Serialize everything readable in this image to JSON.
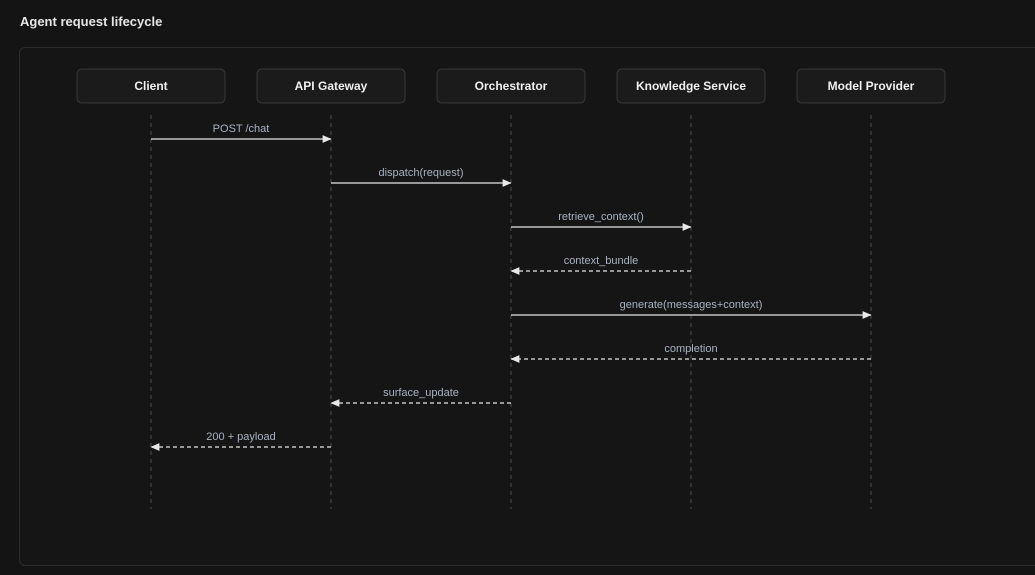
{
  "title": "Agent request lifecycle",
  "actors": [
    {
      "id": "client",
      "label": "Client"
    },
    {
      "id": "gateway",
      "label": "API Gateway"
    },
    {
      "id": "orchestrator",
      "label": "Orchestrator"
    },
    {
      "id": "knowledge",
      "label": "Knowledge Service"
    },
    {
      "id": "model",
      "label": "Model Provider"
    }
  ],
  "messages": [
    {
      "from": 0,
      "to": 1,
      "label": "POST /chat",
      "kind": "call"
    },
    {
      "from": 1,
      "to": 2,
      "label": "dispatch(request)",
      "kind": "call"
    },
    {
      "from": 2,
      "to": 3,
      "label": "retrieve_context()",
      "kind": "call"
    },
    {
      "from": 3,
      "to": 2,
      "label": "context_bundle",
      "kind": "reply"
    },
    {
      "from": 2,
      "to": 4,
      "label": "generate(messages+context)",
      "kind": "call"
    },
    {
      "from": 4,
      "to": 2,
      "label": "completion",
      "kind": "reply"
    },
    {
      "from": 2,
      "to": 1,
      "label": "surface_update",
      "kind": "reply"
    },
    {
      "from": 1,
      "to": 0,
      "label": "200 + payload",
      "kind": "reply"
    }
  ]
}
